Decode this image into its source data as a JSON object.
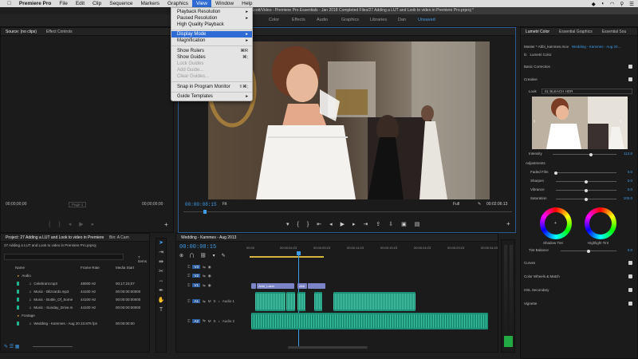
{
  "menubar": {
    "items": [
      "Premiere Pro",
      "File",
      "Edit",
      "Clip",
      "Sequence",
      "Markers",
      "Graphics",
      "View",
      "Window",
      "Help"
    ]
  },
  "titlebar": {
    "title": "Scott/Video - Premiere Pro Essentials - Jan 2018 Completed Files/27 Adding a LUT and Look to video in Premiere Pro.prproj *"
  },
  "workspaces": [
    "Color",
    "Effects",
    "Audio",
    "Graphics",
    "Libraries",
    "Dan",
    "Unsaved"
  ],
  "workspaces_active": "Unsaved",
  "view_menu": {
    "items": [
      {
        "label": "Playback Resolution",
        "shortcut": "",
        "submenu": true,
        "disabled": false
      },
      {
        "label": "Paused Resolution",
        "shortcut": "",
        "submenu": true,
        "disabled": false
      },
      {
        "label": "High Quality Playback",
        "shortcut": "",
        "submenu": false,
        "disabled": false
      },
      {
        "label": "Display Mode",
        "shortcut": "",
        "submenu": true,
        "disabled": false,
        "highlighted": true
      },
      {
        "label": "Magnification",
        "shortcut": "",
        "submenu": true,
        "disabled": false
      },
      {
        "label": "Show Rulers",
        "shortcut": "⌘R",
        "submenu": false,
        "disabled": false
      },
      {
        "label": "Show Guides",
        "shortcut": "⌘;",
        "submenu": false,
        "disabled": false
      },
      {
        "label": "Lock Guides",
        "shortcut": "",
        "submenu": false,
        "disabled": true
      },
      {
        "label": "Add Guide...",
        "shortcut": "",
        "submenu": false,
        "disabled": true
      },
      {
        "label": "Clear Guides...",
        "shortcut": "",
        "submenu": false,
        "disabled": true
      },
      {
        "label": "Snap in Program Monitor",
        "shortcut": "⇧⌘;",
        "submenu": false,
        "disabled": false
      },
      {
        "label": "Guide Templates",
        "shortcut": "",
        "submenu": true,
        "disabled": false
      }
    ]
  },
  "source_panel": {
    "tabs": [
      "Source: (no clips)",
      "Effect Controls"
    ],
    "timecode_left": "00;00;00;00",
    "page": "Page 1",
    "timecode_right": "00;00;00;00"
  },
  "program_monitor": {
    "timecode": "00:00:08:15",
    "fit": "Fit",
    "resolution": "Full",
    "duration": "00:02:06:13"
  },
  "project_panel": {
    "tab": "Project: 27 Adding a LUT and Look to video in Premiere Pro",
    "tab2": "Bin: A Cam",
    "file": "27 Adding a LUT and Look to video in Premiere Pro.prproj",
    "count": "7 Items",
    "columns": [
      "Name",
      "Frame Rate",
      "Media Start"
    ],
    "rows": [
      {
        "name": "Audio",
        "rate": "",
        "start": "",
        "type": "folder",
        "color": "#e8a23a"
      },
      {
        "name": "Celebrant.mp3",
        "rate": "48000 Hz",
        "start": "00;17;23;07",
        "type": "audio",
        "color": "#1fb28c"
      },
      {
        "name": "Music - Blizzards.mp3",
        "rate": "44100 Hz",
        "start": "00:00:00:00000",
        "type": "audio",
        "color": "#1fb28c"
      },
      {
        "name": "Music - Bottle_Of_Some",
        "rate": "44100 Hz",
        "start": "00:00:00:00000",
        "type": "audio",
        "color": "#1fb28c"
      },
      {
        "name": "Music - Sunday_Drive.m",
        "rate": "44100 Hz",
        "start": "00:00:00:00000",
        "type": "audio",
        "color": "#1fb28c"
      },
      {
        "name": "Footage",
        "rate": "",
        "start": "",
        "type": "folder",
        "color": "#e8a23a"
      },
      {
        "name": "Wedding - Kammes - Aug 20",
        "rate": "23.976 fps",
        "start": "00:00:00:00",
        "type": "sequence",
        "color": "#1fb28c"
      }
    ]
  },
  "timeline": {
    "tab": "Wedding - Kammes - Aug 2013",
    "timecode": "00:00:08:15",
    "ruler": [
      "00:00",
      "00:00:04:23",
      "00:00:09:23",
      "00:00:14:23",
      "00:00:19:23",
      "00:00:24:23",
      "00:00:29:23",
      "00:00:34:23"
    ],
    "tracks": [
      {
        "id": "V3",
        "label": ""
      },
      {
        "id": "V2",
        "label": ""
      },
      {
        "id": "V1",
        "label": ""
      },
      {
        "id": "A1",
        "label": "Audio 1"
      },
      {
        "id": "A2",
        "label": "Audio 2"
      }
    ],
    "clips": [
      "Abbi_Lazer",
      "Abb"
    ]
  },
  "lumetri": {
    "tabs": [
      "Lumetri Color",
      "Essential Graphics",
      "Essential Sou"
    ],
    "master": "Master * Abbi_kammes.mov",
    "sequence": "Wedding - Kammes - Aug 20...",
    "fx": "fx",
    "fx_name": "Lumetri Color",
    "sections": {
      "basic": "Basic Correction",
      "creative": "Creative",
      "curves": "Curves",
      "wheels": "Color Wheels & Match",
      "hsl": "HSL Secondary",
      "vignette": "Vignette"
    },
    "look_label": "Look",
    "look_value": "SL BLEACH HDR",
    "intensity_label": "Intensity",
    "intensity_value": "113.8",
    "adjustments": "Adjustments",
    "faded_label": "Faded Film",
    "faded_value": "0.0",
    "sharpen_label": "Sharpen",
    "sharpen_value": "0.0",
    "vibrance_label": "Vibrance",
    "vibrance_value": "0.0",
    "saturation_label": "Saturation",
    "saturation_value": "100.0",
    "shadow_tint": "Shadow Tint",
    "highlight_tint": "Highlight Tint",
    "tint_balance_label": "Tint Balance",
    "tint_balance_value": "0.0"
  },
  "icons": [
    "apple-icon",
    "home-icon",
    "play-icon",
    "step-back-icon",
    "step-forward-icon",
    "wrench-icon",
    "camera-icon",
    "selection-tool-icon",
    "razor-tool-icon",
    "hand-tool-icon",
    "type-tool-icon"
  ],
  "colors": {
    "accent": "#3d9be9",
    "menu_highlight": "#2f6bd5",
    "audio_clip": "#1c8f77",
    "video_clip": "#7a84c7"
  }
}
